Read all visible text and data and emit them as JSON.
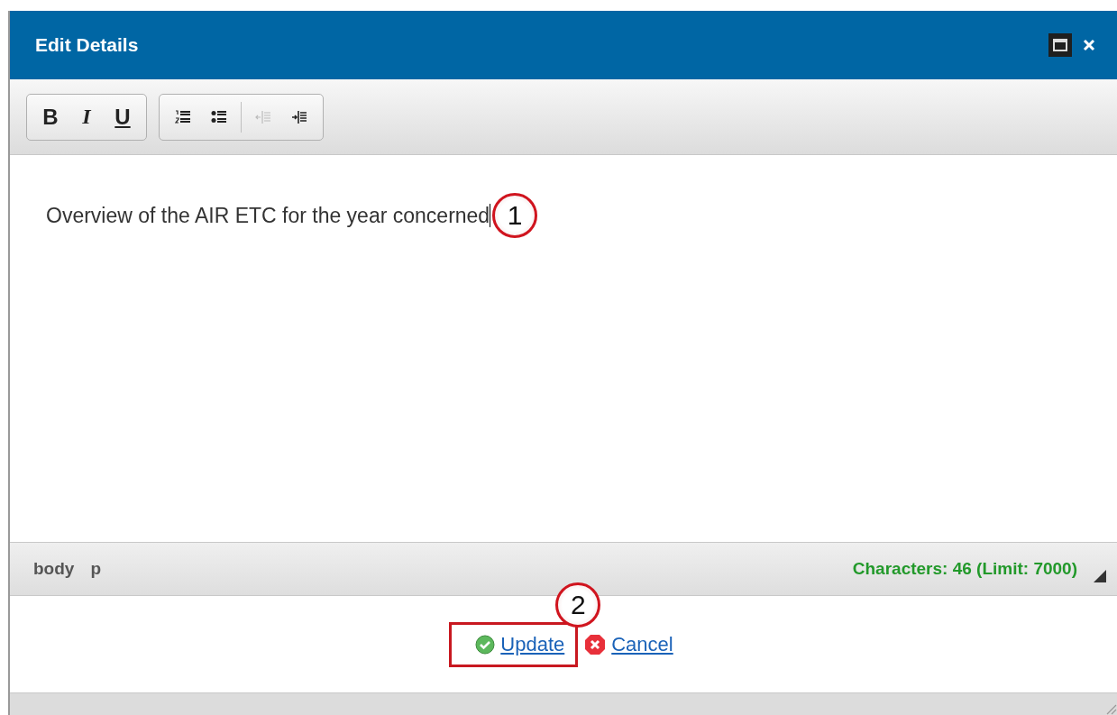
{
  "window": {
    "title": "Edit Details"
  },
  "toolbar": {
    "groups": [
      {
        "buttons": [
          {
            "kind": "bold",
            "label": "B",
            "disabled": false
          },
          {
            "kind": "italic",
            "label": "I",
            "disabled": false
          },
          {
            "kind": "underline",
            "label": "U",
            "disabled": false
          }
        ]
      },
      {
        "buttons": [
          {
            "kind": "ordered-list",
            "disabled": false
          },
          {
            "kind": "bullet-list",
            "disabled": false
          },
          {
            "kind": "separator"
          },
          {
            "kind": "outdent",
            "disabled": true
          },
          {
            "kind": "indent",
            "disabled": false
          }
        ]
      }
    ]
  },
  "editor": {
    "content": "Overview of the AIR ETC for the year concerned",
    "callout": "1"
  },
  "status_bar": {
    "path": [
      "body",
      "p"
    ],
    "counter": "Characters: 46 (Limit: 7000)"
  },
  "actions": [
    {
      "kind": "update",
      "label": "Update",
      "highlighted": true,
      "callout": "2"
    },
    {
      "kind": "cancel",
      "label": "Cancel",
      "highlighted": false
    }
  ]
}
